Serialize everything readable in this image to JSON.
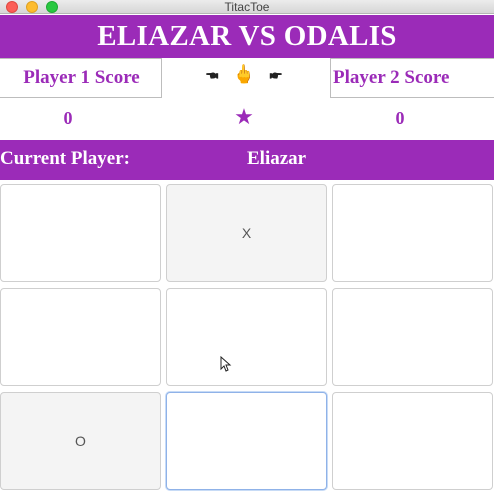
{
  "window": {
    "title": "TitacToe"
  },
  "header": {
    "title": "ELIAZAR VS ODALIS"
  },
  "scores": {
    "player1_label": "Player 1 Score",
    "player2_label": "Player 2 Score",
    "hands": "🖜 🖕 🖝",
    "player1_value": "0",
    "player2_value": "0",
    "star": "★"
  },
  "current": {
    "label": "Current Player:",
    "name": "Eliazar"
  },
  "board": {
    "cells": [
      "",
      "X",
      "",
      "",
      "",
      "",
      "O",
      "",
      ""
    ]
  },
  "colors": {
    "accent": "#9b2bb8",
    "cell_shaded": "#f4f4f4"
  }
}
